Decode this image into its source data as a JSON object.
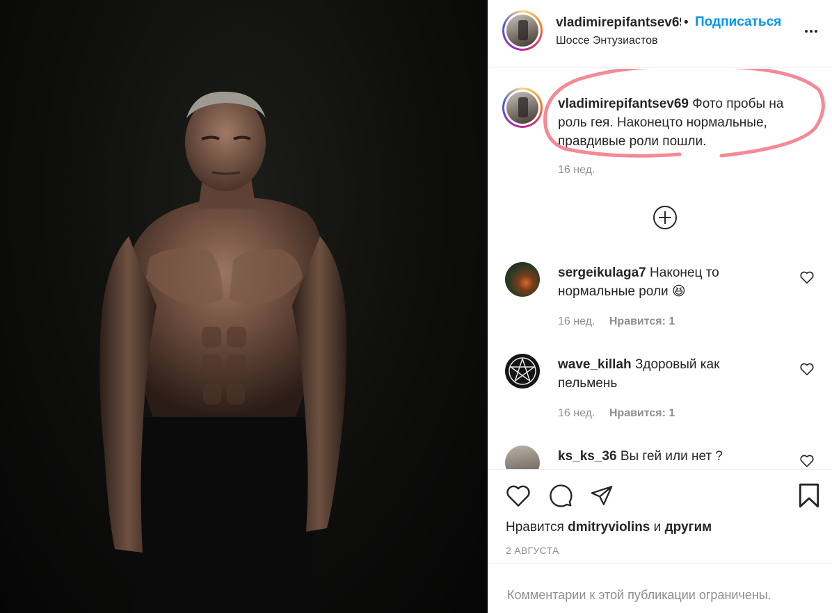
{
  "post": {
    "username": "vladimirepifantsev69",
    "header_username": "vladimirepifantsev69",
    "dot": "•",
    "follow_label": "Подписаться",
    "location": "Шоссе Энтузиастов"
  },
  "caption": {
    "username": "vladimirepifantsev69",
    "text": "Фото пробы на роль гея. Наконецто нормальные, правдивые роли пошли.",
    "time": "16 нед."
  },
  "comments": [
    {
      "username": "sergeikulaga7",
      "text": "Наконец то нормальные роли 😆",
      "time": "16 нед.",
      "likes": "Нравится: 1"
    },
    {
      "username": "wave_killah",
      "text": "Здоровый как пельмень",
      "time": "16 нед.",
      "likes": "Нравится: 1"
    },
    {
      "username": "ks_ks_36",
      "text": "Вы гей или нет ?",
      "time": "",
      "likes": ""
    }
  ],
  "likes_summary": {
    "prefix": "Нравится",
    "user": "dmitryviolins",
    "conj": "и",
    "others": "другим"
  },
  "date": "2 АВГУСТА",
  "comments_restricted": "Комментарии к этой публикации ограничены.",
  "colors": {
    "follow": "#0095f6",
    "secondary_text": "#8e8e8e",
    "annotation": "#f48a96",
    "border": "#efefef"
  },
  "icons": [
    "more-icon",
    "add-comments-icon",
    "heart-icon",
    "comment-icon",
    "share-icon",
    "save-icon"
  ]
}
